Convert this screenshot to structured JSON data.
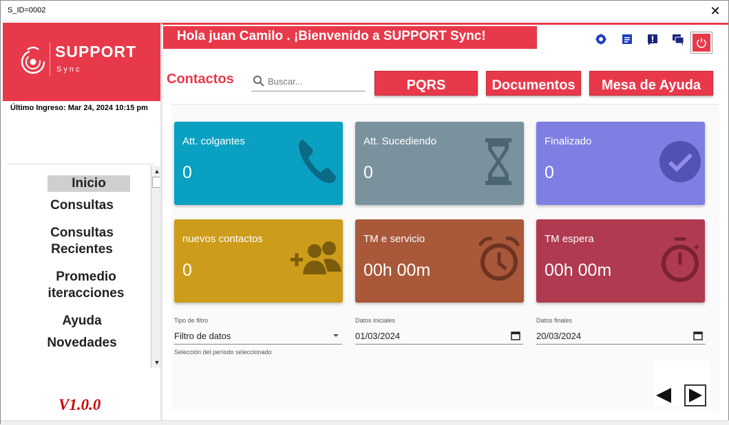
{
  "window": {
    "title": "S_ID=0002",
    "close_glyph": "✕"
  },
  "brand": {
    "name": "SUPPORT",
    "sub": "Sync",
    "color": "#e8394a"
  },
  "sidebar": {
    "last_login": "Último Ingreso: Mar 24, 2024 10:15 pm",
    "items": [
      {
        "label": "Inicio",
        "active": true
      },
      {
        "label": "Consultas"
      },
      {
        "label": "Consultas"
      },
      {
        "label": "Recientes"
      },
      {
        "label": "Promedio"
      },
      {
        "label": "iteracciones"
      },
      {
        "label": "Ayuda"
      },
      {
        "label": "Novedades"
      }
    ],
    "version": "V1.0.0"
  },
  "header": {
    "greeting": "Hola juan Camilo . ¡Bienvenido a SUPPORT Sync!",
    "icons": [
      "settings-icon",
      "notes-icon",
      "alert-icon",
      "chat-icon",
      "power-icon"
    ]
  },
  "toolbar": {
    "section_title": "Contactos",
    "search_placeholder": "Buscar...",
    "buttons": [
      "PQRS",
      "Documentos",
      "Mesa de Ayuda"
    ]
  },
  "cards": [
    {
      "title": "Att. colgantes",
      "value": "0",
      "color": "#0aa0c2",
      "icon": "phone-icon"
    },
    {
      "title": "Att. Sucediendo",
      "value": "0",
      "color": "#7a929e",
      "icon": "hourglass-icon"
    },
    {
      "title": "Finalizado",
      "value": "0",
      "color": "#7e7ee3",
      "icon": "check-circle-icon"
    },
    {
      "title": "nuevos contactos",
      "value": "0",
      "color": "#cc9c1a",
      "icon": "add-group-icon"
    },
    {
      "title": "TM   e servicio",
      "value": "00h 00m",
      "color": "#a9583a",
      "icon": "alarm-clock-icon"
    },
    {
      "title": "TM espera",
      "value": "00h 00m",
      "color": "#b03a50",
      "icon": "stopwatch-icon"
    }
  ],
  "filters": {
    "type_label": "Tipo de filtro",
    "type_value": "Filtro de datos",
    "type_help": "Selección del período seleccionado",
    "start_label": "Datos iniciales",
    "start_value": "01/03/2024",
    "end_label": "Datos finales",
    "end_value": "20/03/2024"
  }
}
